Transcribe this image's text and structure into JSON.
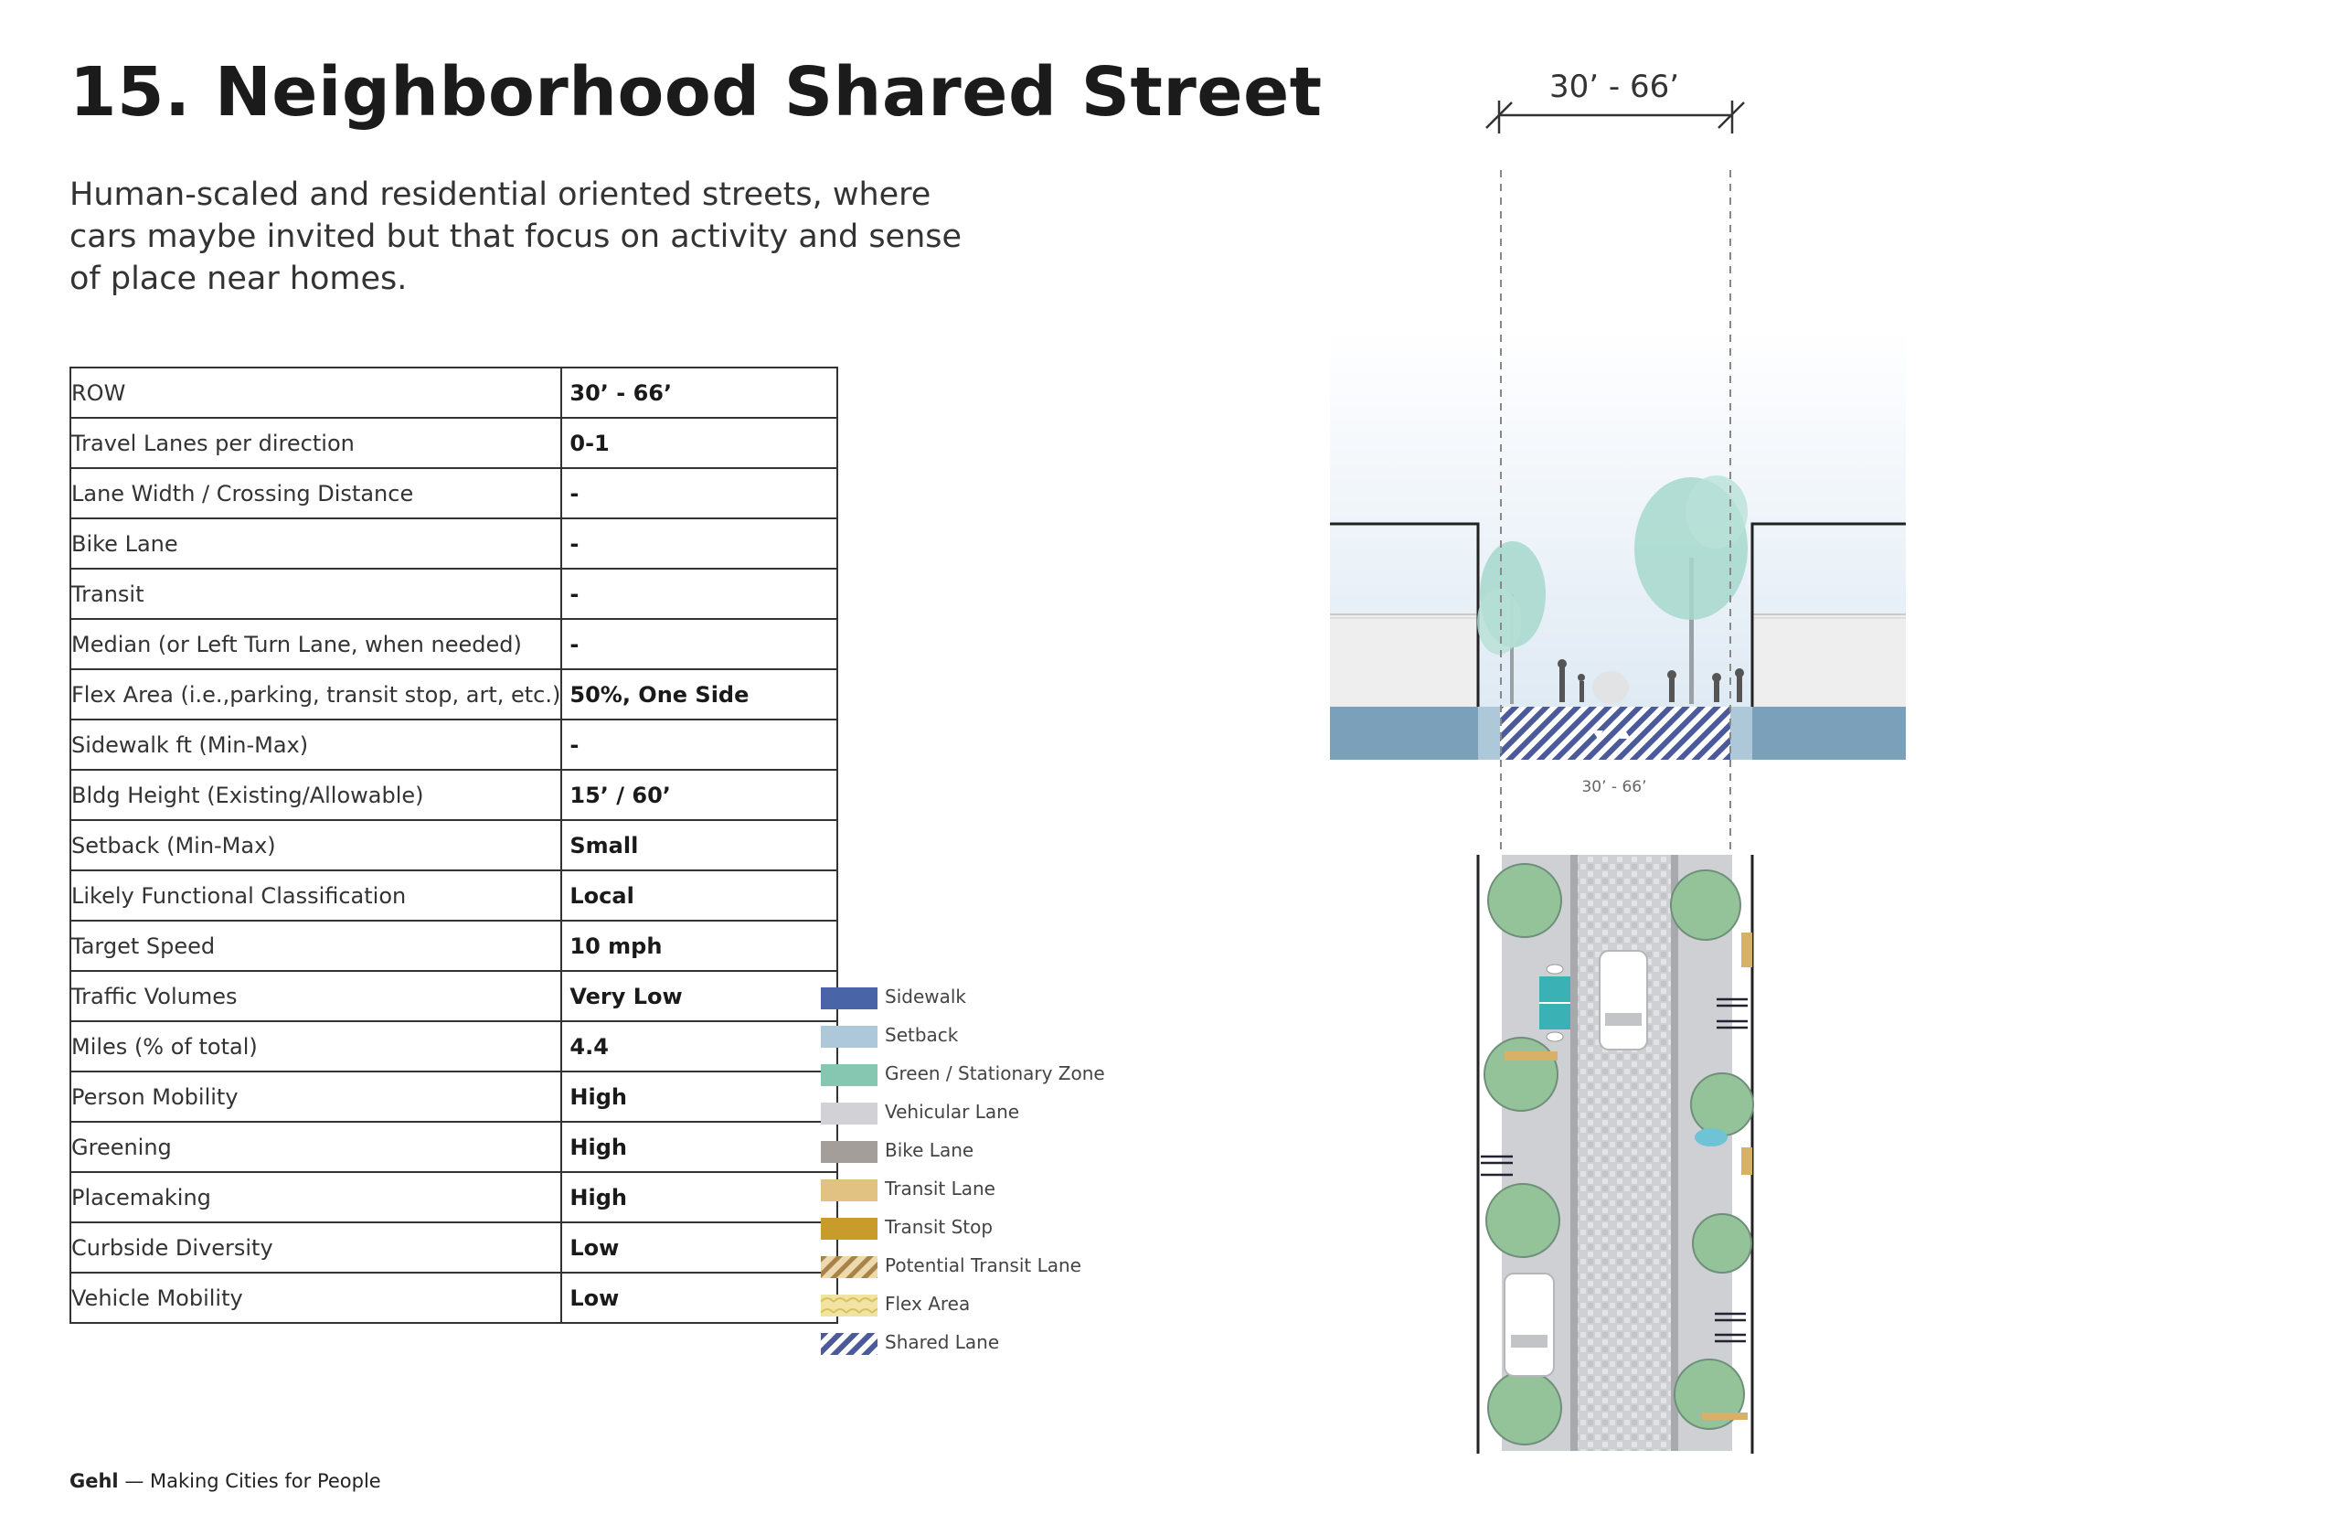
{
  "title": "15. Neighborhood Shared Street",
  "subtitle": "Human-scaled and residential oriented streets, where cars maybe invited but that focus on activity and sense of place near homes.",
  "table": [
    {
      "label": "ROW",
      "value": "30’ - 66’"
    },
    {
      "label": "Travel Lanes per direction",
      "value": "0-1"
    },
    {
      "label": "Lane Width / Crossing Distance",
      "value": "-"
    },
    {
      "label": "Bike Lane",
      "value": "-"
    },
    {
      "label": "Transit",
      "value": "-"
    },
    {
      "label": "Median (or Left Turn Lane, when needed)",
      "value": "-"
    },
    {
      "label": "Flex Area (i.e.,parking, transit stop, art, etc.)",
      "value": "50%, One Side"
    },
    {
      "label": "Sidewalk ft (Min-Max)",
      "value": "-"
    },
    {
      "label": "Bldg Height (Existing/Allowable)",
      "value": "15’ / 60’"
    },
    {
      "label": "Setback (Min-Max)",
      "value": "Small"
    },
    {
      "label": "Likely Functional Classification",
      "value": "Local"
    },
    {
      "label": "Target Speed",
      "value": "10 mph"
    },
    {
      "label": "Traffic Volumes",
      "value": "Very Low"
    },
    {
      "label": "Miles (% of total)",
      "value": "4.4"
    },
    {
      "label": "Person Mobility",
      "value": "High"
    },
    {
      "label": "Greening",
      "value": "High"
    },
    {
      "label": "Placemaking",
      "value": "High"
    },
    {
      "label": "Curbside Diversity",
      "value": "Low"
    },
    {
      "label": "Vehicle Mobility",
      "value": "Low"
    }
  ],
  "legend": [
    {
      "label": "Sidewalk",
      "color": "#4a64a8",
      "pattern": "solid"
    },
    {
      "label": "Setback",
      "color": "#adc8d9",
      "pattern": "solid"
    },
    {
      "label": "Green / Stationary Zone",
      "color": "#86c7b2",
      "pattern": "solid"
    },
    {
      "label": "Vehicular Lane",
      "color": "#d2d2d6",
      "pattern": "solid"
    },
    {
      "label": "Bike Lane",
      "color": "#a39e9a",
      "pattern": "solid"
    },
    {
      "label": "Transit Lane",
      "color": "#e2c282",
      "pattern": "solid"
    },
    {
      "label": "Transit Stop",
      "color": "#c99b2a",
      "pattern": "solid"
    },
    {
      "label": "Potential Transit Lane",
      "color": "#b08c52",
      "pattern": "hatch-tan"
    },
    {
      "label": "Flex Area",
      "color": "#ead98a",
      "pattern": "scallop"
    },
    {
      "label": "Shared Lane",
      "color": "#4a5a9a",
      "pattern": "hatch-blue"
    }
  ],
  "drawing": {
    "row_dimension": "30’ - 66’",
    "section_dimension": "30’ - 66’",
    "colors": {
      "ground": "#7aa1b9",
      "shared_lane": "#4a5a9a",
      "tree": "#a6d8cd",
      "plaza": "#c8c9cc"
    }
  },
  "footer": {
    "brand": "Gehl",
    "tagline": " — Making Cities for People"
  }
}
